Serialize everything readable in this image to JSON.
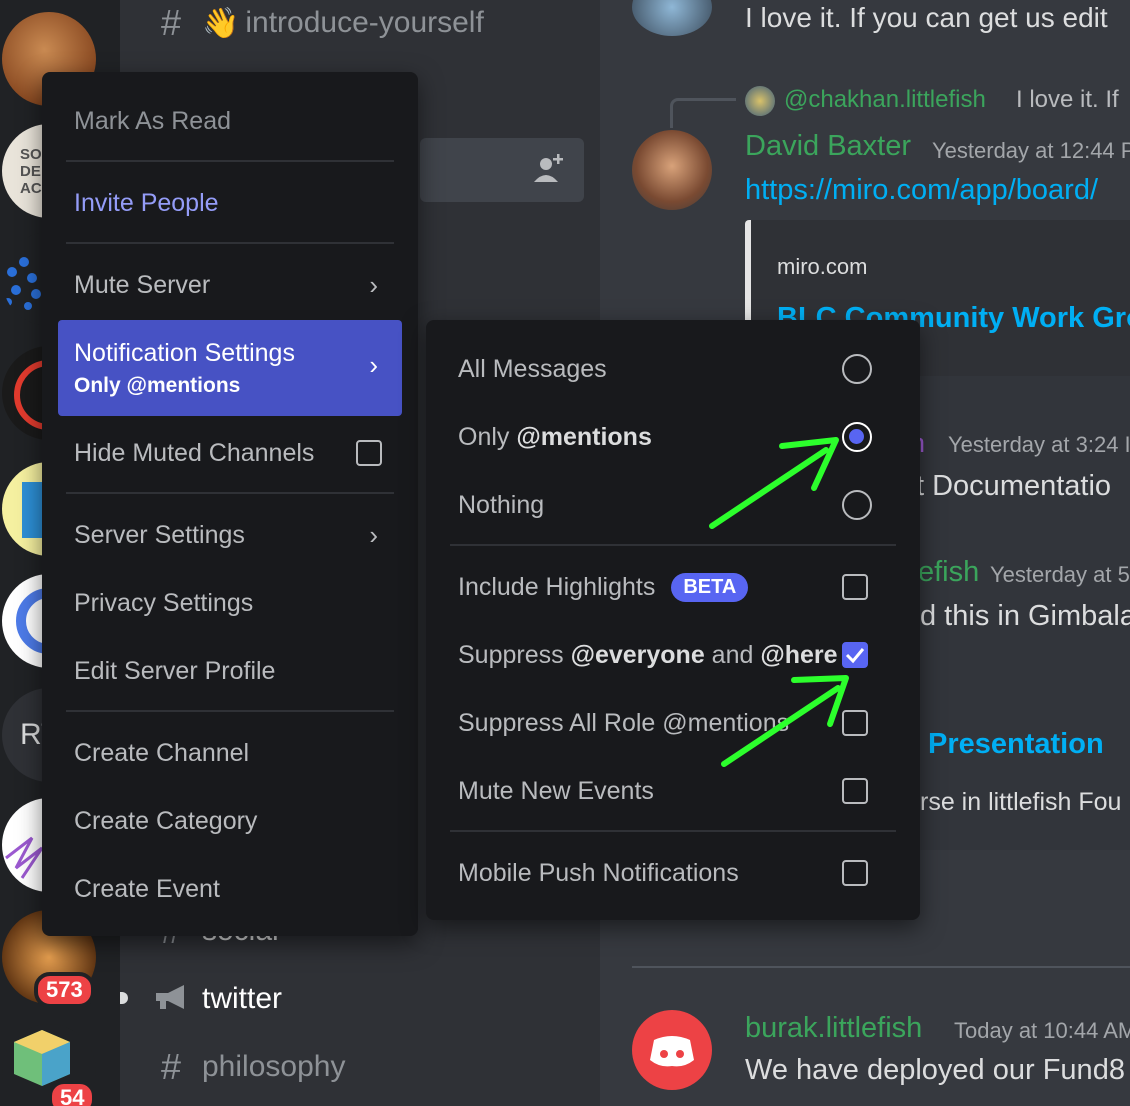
{
  "colors": {
    "accent": "#5865f2",
    "rail_bg": "#202225",
    "channels_bg": "#2f3136",
    "chat_bg": "#36393f",
    "menu_bg": "#18191c",
    "username_green": "#3ba55c",
    "link_blue": "#00aff4",
    "arrow_green": "#2cff2c",
    "badge_red": "#ed4245"
  },
  "rail": {
    "partial_text_1": "SO\nDE\nACA",
    "partial_text_2": "RT",
    "badge_1": "573",
    "badge_2": "54"
  },
  "channels": {
    "top_channel": "introduce-yourself",
    "top_channel_emoji": "👋",
    "partial_social": "social",
    "twitter": "twitter",
    "philosophy": "philosophy"
  },
  "context_menu": {
    "mark_as_read": "Mark As Read",
    "invite_people": "Invite People",
    "mute_server": "Mute Server",
    "notification_settings": "Notification Settings",
    "notification_settings_value": "Only @mentions",
    "hide_muted_channels": "Hide Muted Channels",
    "server_settings": "Server Settings",
    "privacy_settings": "Privacy Settings",
    "edit_server_profile": "Edit Server Profile",
    "create_channel": "Create Channel",
    "create_category": "Create Category",
    "create_event": "Create Event"
  },
  "submenu": {
    "all_messages": "All Messages",
    "only_prefix": "Only ",
    "only_bold": "@mentions",
    "nothing": "Nothing",
    "include_highlights": "Include Highlights",
    "beta": "BETA",
    "suppress_a": "Suppress ",
    "suppress_b": "@everyone",
    "suppress_c": " and ",
    "suppress_d": "@here",
    "suppress_role": "Suppress All Role @mentions",
    "mute_new_events": "Mute New Events",
    "mobile_push": "Mobile Push Notifications",
    "selected_option": "Only @mentions",
    "include_highlights_checked": false,
    "suppress_everyone_checked": true,
    "suppress_roles_checked": false,
    "mute_new_events_checked": false,
    "mobile_push_checked": false
  },
  "chat": {
    "top_message": "I love it. If you can get us edit",
    "reply_user": "@chakhan.littlefish",
    "reply_text": "I love it. If",
    "author_1": "David Baxter",
    "time_1": "Yesterday at 12:44 P",
    "link_1": "https://miro.com/app/board/",
    "embed_site": "miro.com",
    "embed_title": "BLC Community Work Gro",
    "partial_author_2": "n",
    "time_2": "Yesterday at 3:24 I",
    "text_2": "t Documentatio",
    "partial_author_3": "efish",
    "time_3": "Yesterday at 5",
    "text_3": "d this in Gimbala",
    "title_4": "Presentation",
    "text_4": "rse in littlefish Fou",
    "author_5": "burak.littlefish",
    "time_5": "Today at 10:44 AM",
    "text_5": "We have deployed our Fund8"
  }
}
